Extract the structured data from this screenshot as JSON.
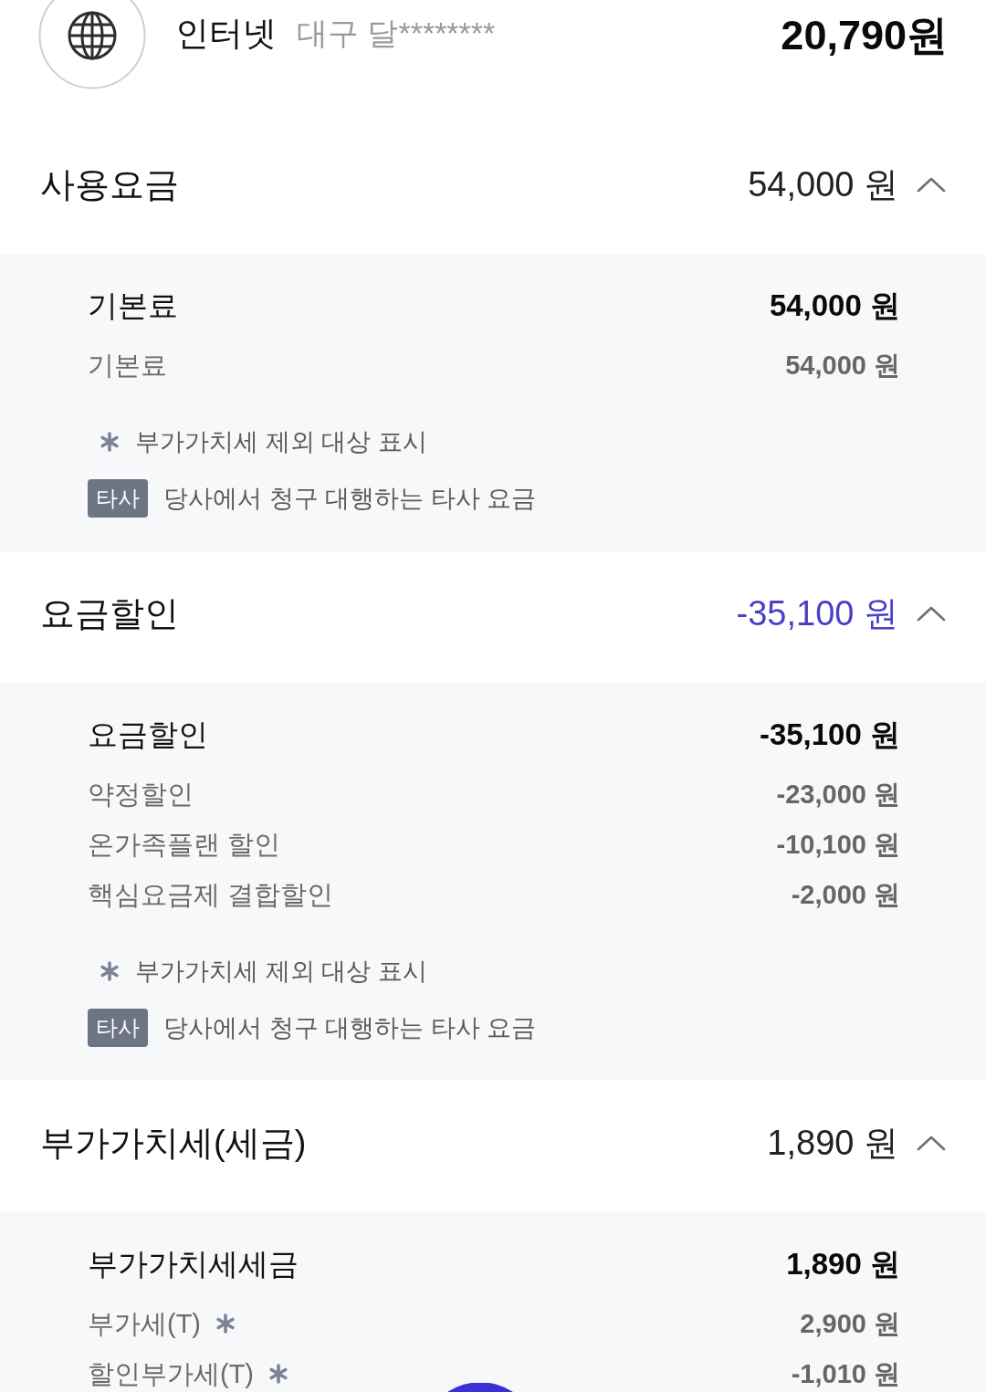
{
  "service": {
    "name": "인터넷",
    "account": "대구 달********",
    "total": "20,790원"
  },
  "sections": [
    {
      "title": "사용요금",
      "amount": "54,000 원",
      "color": "#222222",
      "expanded": true,
      "detail": {
        "title": "기본료",
        "amount": "54,000 원",
        "items": [
          {
            "label": "기본료",
            "amount": "54,000 원",
            "vat_exempt": false
          }
        ]
      },
      "legend": [
        {
          "kind": "asterisk",
          "text": "부가가치세 제외 대상 표시"
        },
        {
          "kind": "badge",
          "badge": "타사",
          "text": "당사에서 청구 대행하는 타사 요금"
        }
      ]
    },
    {
      "title": "요금할인",
      "amount": "-35,100 원",
      "color": "#4b3fc6",
      "expanded": true,
      "detail": {
        "title": "요금할인",
        "amount": "-35,100 원",
        "items": [
          {
            "label": "약정할인",
            "amount": "-23,000 원",
            "vat_exempt": false
          },
          {
            "label": "온가족플랜 할인",
            "amount": "-10,100 원",
            "vat_exempt": false
          },
          {
            "label": "핵심요금제 결합할인",
            "amount": "-2,000 원",
            "vat_exempt": false
          }
        ]
      },
      "legend": [
        {
          "kind": "asterisk",
          "text": "부가가치세 제외 대상 표시"
        },
        {
          "kind": "badge",
          "badge": "타사",
          "text": "당사에서 청구 대행하는 타사 요금"
        }
      ]
    },
    {
      "title": "부가가치세(세금)",
      "amount": "1,890 원",
      "color": "#222222",
      "expanded": true,
      "detail": {
        "title": "부가가치세세금",
        "amount": "1,890 원",
        "items": [
          {
            "label": "부가세(T)",
            "amount": "2,900 원",
            "vat_exempt": true
          },
          {
            "label": "할인부가세(T)",
            "amount": "-1,010 원",
            "vat_exempt": true
          }
        ]
      }
    }
  ]
}
